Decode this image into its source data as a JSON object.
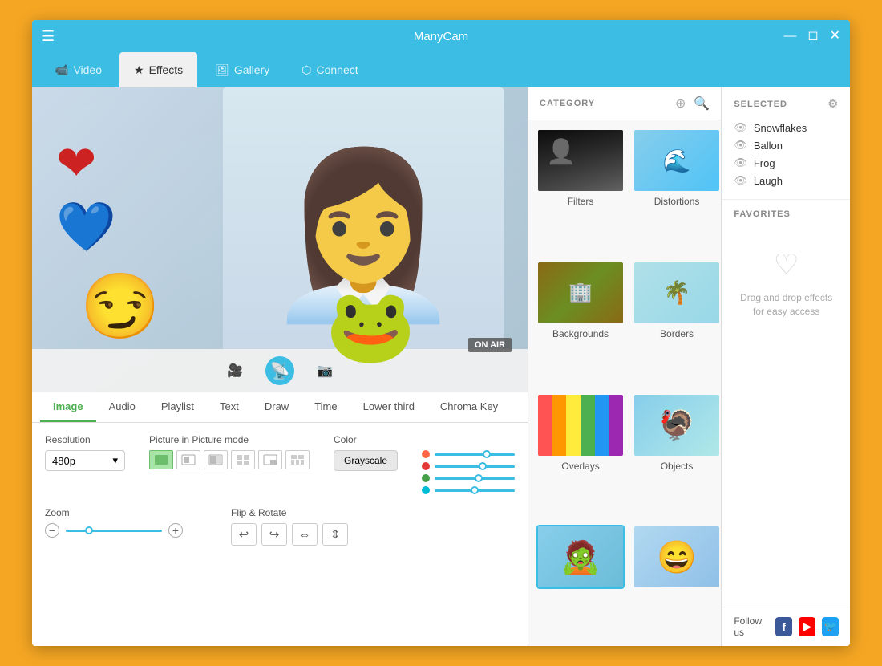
{
  "app": {
    "title": "ManyCam",
    "window_controls": {
      "minimize": "—",
      "maximize": "◻",
      "close": "✕"
    }
  },
  "nav": {
    "tabs": [
      {
        "id": "video",
        "label": "Video",
        "icon": "📹",
        "active": false
      },
      {
        "id": "effects",
        "label": "Effects",
        "icon": "★",
        "active": true
      },
      {
        "id": "gallery",
        "label": "Gallery",
        "icon": "🖼",
        "active": false
      },
      {
        "id": "connect",
        "label": "Connect",
        "icon": "⬡",
        "active": false
      }
    ]
  },
  "preview": {
    "on_air_label": "ON AIR"
  },
  "sub_tabs": [
    {
      "id": "image",
      "label": "Image",
      "active": true
    },
    {
      "id": "audio",
      "label": "Audio",
      "active": false
    },
    {
      "id": "playlist",
      "label": "Playlist",
      "active": false
    },
    {
      "id": "text",
      "label": "Text",
      "active": false
    },
    {
      "id": "draw",
      "label": "Draw",
      "active": false
    },
    {
      "id": "time",
      "label": "Time",
      "active": false
    },
    {
      "id": "lower_third",
      "label": "Lower third",
      "active": false
    },
    {
      "id": "chroma_key",
      "label": "Chroma Key",
      "active": false
    }
  ],
  "settings": {
    "resolution_label": "Resolution",
    "resolution_value": "480p",
    "pip_label": "Picture in Picture mode",
    "color_label": "Color",
    "grayscale_btn": "Grayscale",
    "zoom_label": "Zoom",
    "flip_rotate_label": "Flip & Rotate"
  },
  "category": {
    "title": "CATEGORY",
    "items": [
      {
        "id": "filters",
        "label": "Filters"
      },
      {
        "id": "distortions",
        "label": "Distortions"
      },
      {
        "id": "backgrounds",
        "label": "Backgrounds"
      },
      {
        "id": "borders",
        "label": "Borders"
      },
      {
        "id": "overlays",
        "label": "Overlays"
      },
      {
        "id": "objects",
        "label": "Objects"
      },
      {
        "id": "face1",
        "label": ""
      },
      {
        "id": "face2",
        "label": ""
      }
    ]
  },
  "selected": {
    "title": "SELECTED",
    "items": [
      {
        "label": "Snowflakes"
      },
      {
        "label": "Ballon"
      },
      {
        "label": "Frog"
      },
      {
        "label": "Laugh"
      }
    ]
  },
  "favorites": {
    "title": "FAVORITES",
    "drag_drop_text": "Drag and drop effects for easy access"
  },
  "social": {
    "follow_text": "Follow us"
  }
}
